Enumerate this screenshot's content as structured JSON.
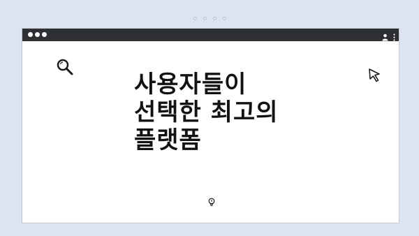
{
  "headline": {
    "line1": "사용자들이",
    "line2": "선택한 최고의",
    "line3": "플랫폼"
  },
  "icons": {
    "search": "search-icon",
    "cursor": "cursor-arrow-icon",
    "bulb": "lightbulb-icon",
    "user": "user-icon",
    "menu": "kebab-menu-icon"
  },
  "colors": {
    "background": "#dde4ef",
    "titlebar": "#2e2f33",
    "window": "#ffffff",
    "text": "#121212"
  }
}
